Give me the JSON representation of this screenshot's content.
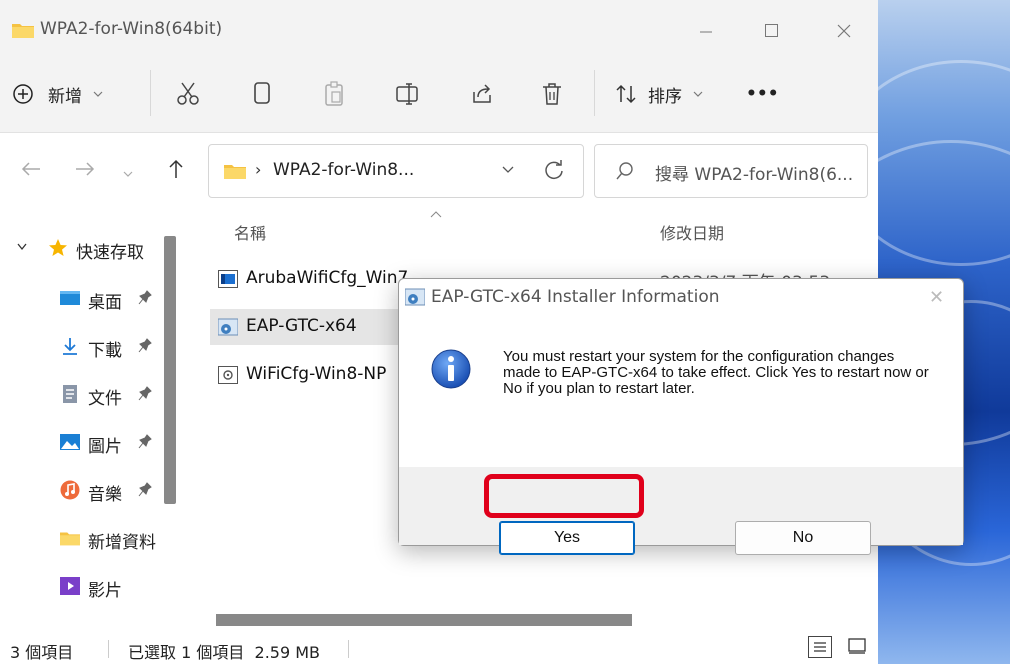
{
  "window": {
    "title": "WPA2-for-Win8(64bit)"
  },
  "toolbar": {
    "new_label": "新增",
    "sort_label": "排序",
    "more_label": "•••"
  },
  "address": {
    "path": "WPA2-for-Win8...",
    "search_placeholder": "搜尋 WPA2-for-Win8(6..."
  },
  "sidebar": {
    "items": [
      {
        "label": "快速存取",
        "icon": "star-icon"
      },
      {
        "label": "桌面",
        "icon": "desktop-icon"
      },
      {
        "label": "下載",
        "icon": "download-icon"
      },
      {
        "label": "文件",
        "icon": "document-icon"
      },
      {
        "label": "圖片",
        "icon": "pictures-icon"
      },
      {
        "label": "音樂",
        "icon": "music-icon"
      },
      {
        "label": "新增資料",
        "icon": "folder-icon"
      },
      {
        "label": "影片",
        "icon": "video-icon"
      }
    ]
  },
  "list": {
    "col_name": "名稱",
    "col_date": "修改日期",
    "rows": [
      {
        "name": "ArubaWifiCfg_Win7",
        "date": "2023/3/7 下午 03:53"
      },
      {
        "name": "EAP-GTC-x64",
        "selected": true
      },
      {
        "name": "WiFiCfg-Win8-NP"
      }
    ]
  },
  "status": {
    "count": "3 個項目",
    "selected": "已選取 1 個項目  2.59 MB"
  },
  "dialog": {
    "title": "EAP-GTC-x64 Installer Information",
    "message": "You must restart your system for the configuration changes made to EAP-GTC-x64 to take effect. Click Yes to restart now or No if you plan to restart later.",
    "yes_label": "Yes",
    "no_label": "No",
    "close_label": "✕"
  },
  "colors": {
    "highlight": "#e0001b",
    "accent": "#0067c0",
    "folder": "#f5c242"
  }
}
